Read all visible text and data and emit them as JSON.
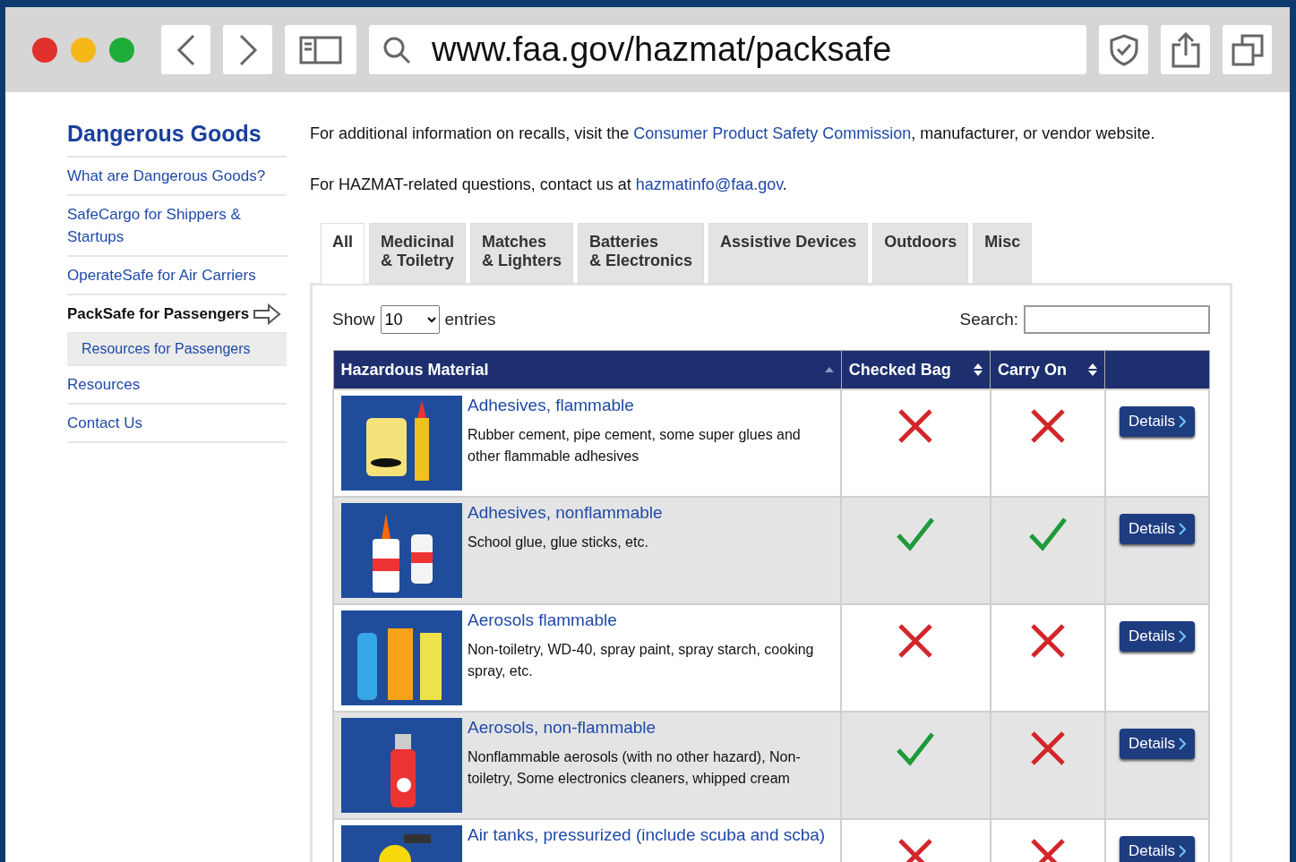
{
  "browser": {
    "url": "www.faa.gov/hazmat/packsafe"
  },
  "sidebar": {
    "title": "Dangerous Goods",
    "items": [
      {
        "label": "What are Dangerous Goods?",
        "selected": false
      },
      {
        "label": "SafeCargo for Shippers & Startups",
        "selected": false
      },
      {
        "label": "OperateSafe for Air Carriers",
        "selected": false
      },
      {
        "label": "PackSafe for Passengers",
        "selected": true,
        "children": [
          {
            "label": "Resources for Passengers",
            "selected": false
          }
        ]
      },
      {
        "label": "Resources",
        "selected": false
      },
      {
        "label": "Contact Us",
        "selected": false
      }
    ]
  },
  "intro": [
    {
      "before": "For additional information on recalls, visit the ",
      "link": "Consumer Product Safety Commission",
      "after": ", manufacturer, or vendor website."
    },
    {
      "before": "For HAZMAT-related questions, contact us at ",
      "link": "hazmatinfo@faa.gov",
      "after": "."
    }
  ],
  "tabs": [
    {
      "label": "All",
      "selected": true
    },
    {
      "label": "Medicinal\n& Toiletry",
      "selected": false
    },
    {
      "label": "Matches\n& Lighters",
      "selected": false
    },
    {
      "label": "Batteries\n& Electronics",
      "selected": false
    },
    {
      "label": "Assistive Devices",
      "selected": false
    },
    {
      "label": "Outdoors",
      "selected": false
    },
    {
      "label": "Misc",
      "selected": false
    }
  ],
  "length_control": {
    "before": "Show",
    "value": "10",
    "after": "entries"
  },
  "search": {
    "label": "Search:"
  },
  "table": {
    "columns": [
      {
        "label": "Hazardous Material",
        "sorted": true
      },
      {
        "label": "Checked Bag",
        "sorted": false
      },
      {
        "label": "Carry On",
        "sorted": false
      }
    ],
    "rows": [
      {
        "title": "Adhesives, flammable",
        "description": "Rubber cement, pipe cement, some super glues and other flammable adhesives",
        "checked_bag": false,
        "carry_on": false,
        "action": "Details"
      },
      {
        "title": "Adhesives, nonflammable",
        "description": "School glue, glue sticks, etc.",
        "checked_bag": true,
        "carry_on": true,
        "action": "Details"
      },
      {
        "title": "Aerosols flammable",
        "description": "Non-toiletry, WD-40, spray paint, spray starch, cooking spray, etc.",
        "checked_bag": false,
        "carry_on": false,
        "action": "Details"
      },
      {
        "title": "Aerosols, non-flammable",
        "description": "Nonflammable aerosols (with no other hazard), Non-toiletry, Some electronics cleaners, whipped cream",
        "checked_bag": true,
        "carry_on": false,
        "action": "Details"
      },
      {
        "title": "Air tanks, pressurized (include scuba and scba)",
        "checked_bag": false,
        "carry_on": false,
        "action": "Details"
      }
    ]
  }
}
